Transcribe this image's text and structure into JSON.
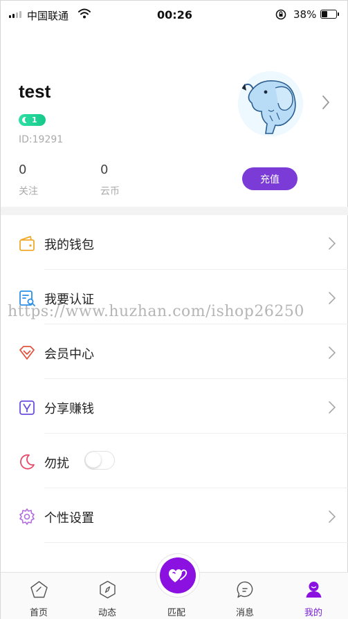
{
  "status_bar": {
    "carrier": "中国联通",
    "time": "00:26",
    "battery_percent": "38%",
    "battery_level": 0.38
  },
  "profile": {
    "username": "test",
    "level": "1",
    "user_id": "ID:19291",
    "stats": [
      {
        "value": "0",
        "label": "关注"
      },
      {
        "value": "0",
        "label": "云币"
      }
    ],
    "recharge_label": "充值"
  },
  "menu": [
    {
      "label": "我的钱包",
      "icon": "wallet-icon",
      "color": "#f0a928"
    },
    {
      "label": "我要认证",
      "icon": "certify-icon",
      "color": "#2b8fe8"
    },
    {
      "label": "会员中心",
      "icon": "diamond-icon",
      "color": "#e2543e"
    },
    {
      "label": "分享赚钱",
      "icon": "share-money-icon",
      "color": "#6b4ee0"
    },
    {
      "label": "勿扰",
      "icon": "moon-icon",
      "color": "#e84a6a",
      "toggle_on": false
    },
    {
      "label": "个性设置",
      "icon": "gear-icon",
      "color": "#b36be0"
    }
  ],
  "watermark": "https://www.huzhan.com/ishop26250",
  "tabbar": {
    "items": [
      {
        "label": "首页",
        "icon": "home-icon"
      },
      {
        "label": "动态",
        "icon": "compass-icon"
      },
      {
        "label": "匹配",
        "icon": "hearts-icon"
      },
      {
        "label": "消息",
        "icon": "message-icon"
      },
      {
        "label": "我的",
        "icon": "profile-icon"
      }
    ],
    "active": "我的",
    "accent": "#7a1fd6"
  }
}
